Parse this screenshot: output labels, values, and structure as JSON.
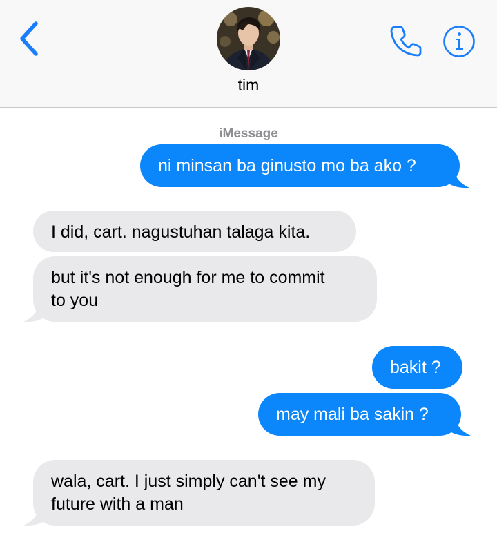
{
  "header": {
    "contact_name": "tim",
    "back_icon": "chevron-left-icon",
    "call_icon": "phone-icon",
    "info_icon": "info-icon",
    "accent_color": "#1a7efb"
  },
  "conversation": {
    "service_label": "iMessage",
    "messages": [
      {
        "direction": "sent",
        "text": "ni minsan ba ginusto mo ba ako ?"
      },
      {
        "direction": "received",
        "text": "I did, cart. nagustuhan talaga kita."
      },
      {
        "direction": "received",
        "lines": [
          "but it's not enough for me to commit",
          "to you"
        ]
      },
      {
        "direction": "sent",
        "text": "bakit ?"
      },
      {
        "direction": "sent",
        "text": "may mali ba sakin ?"
      },
      {
        "direction": "received",
        "lines": [
          "wala, cart. I just simply can't see my",
          "future with a man"
        ]
      }
    ],
    "sent_color": "#0b86fb",
    "received_color": "#e9e9eb"
  }
}
